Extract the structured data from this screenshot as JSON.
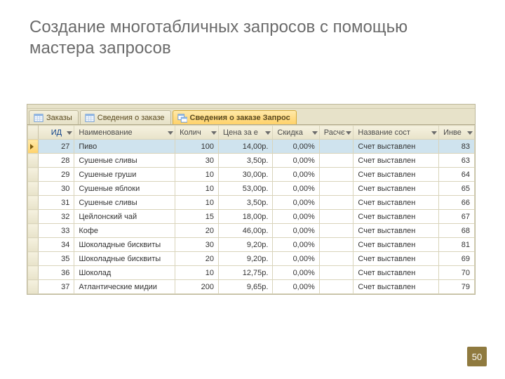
{
  "slide": {
    "title": "Создание многотабличных запросов с помощью мастера запросов",
    "page_number": "50"
  },
  "tabs": [
    {
      "label": "Заказы"
    },
    {
      "label": "Сведения о заказе"
    },
    {
      "label": "Сведения о заказе Запрос"
    }
  ],
  "columns": {
    "id": "ИД",
    "name": "Наименование",
    "qty": "Колич",
    "price": "Цена за е",
    "discount": "Скидка",
    "calc": "Расчє",
    "status": "Название сост",
    "inv": "Инве"
  },
  "rows": [
    {
      "id": "27",
      "name": "Пиво",
      "qty": "100",
      "price": "14,00p.",
      "discount": "0,00%",
      "calc": "",
      "status": "Счет выставлен",
      "inv": "83",
      "selected": true
    },
    {
      "id": "28",
      "name": "Сушеные сливы",
      "qty": "30",
      "price": "3,50p.",
      "discount": "0,00%",
      "calc": "",
      "status": "Счет выставлен",
      "inv": "63"
    },
    {
      "id": "29",
      "name": "Сушеные груши",
      "qty": "10",
      "price": "30,00p.",
      "discount": "0,00%",
      "calc": "",
      "status": "Счет выставлен",
      "inv": "64"
    },
    {
      "id": "30",
      "name": "Сушеные яблоки",
      "qty": "10",
      "price": "53,00p.",
      "discount": "0,00%",
      "calc": "",
      "status": "Счет выставлен",
      "inv": "65"
    },
    {
      "id": "31",
      "name": "Сушеные сливы",
      "qty": "10",
      "price": "3,50p.",
      "discount": "0,00%",
      "calc": "",
      "status": "Счет выставлен",
      "inv": "66"
    },
    {
      "id": "32",
      "name": "Цейлонский чай",
      "qty": "15",
      "price": "18,00p.",
      "discount": "0,00%",
      "calc": "",
      "status": "Счет выставлен",
      "inv": "67"
    },
    {
      "id": "33",
      "name": "Кофе",
      "qty": "20",
      "price": "46,00p.",
      "discount": "0,00%",
      "calc": "",
      "status": "Счет выставлен",
      "inv": "68"
    },
    {
      "id": "34",
      "name": "Шоколадные бисквиты",
      "qty": "30",
      "price": "9,20p.",
      "discount": "0,00%",
      "calc": "",
      "status": "Счет выставлен",
      "inv": "81"
    },
    {
      "id": "35",
      "name": "Шоколадные бисквиты",
      "qty": "20",
      "price": "9,20p.",
      "discount": "0,00%",
      "calc": "",
      "status": "Счет выставлен",
      "inv": "69"
    },
    {
      "id": "36",
      "name": "Шоколад",
      "qty": "10",
      "price": "12,75p.",
      "discount": "0,00%",
      "calc": "",
      "status": "Счет выставлен",
      "inv": "70"
    },
    {
      "id": "37",
      "name": "Атлантические мидии",
      "qty": "200",
      "price": "9,65p.",
      "discount": "0,00%",
      "calc": "",
      "status": "Счет выставлен",
      "inv": "79"
    }
  ]
}
